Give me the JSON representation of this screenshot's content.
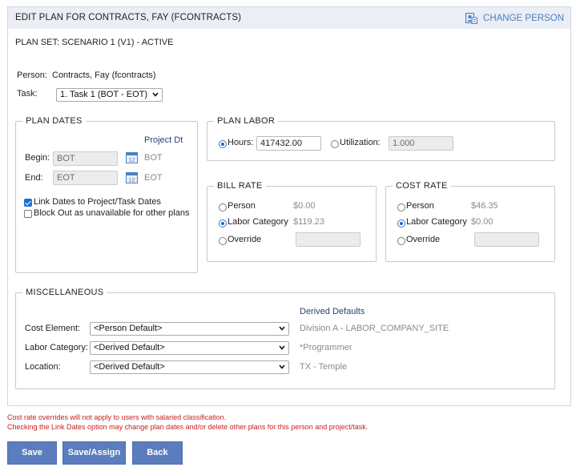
{
  "header": {
    "title": "EDIT PLAN FOR CONTRACTS, FAY (FCONTRACTS)",
    "change_person": "CHANGE PERSON"
  },
  "plan_set": "PLAN SET:  SCENARIO 1 (V1) - ACTIVE",
  "person": {
    "label": "Person:",
    "value": "Contracts, Fay (fcontracts)"
  },
  "task": {
    "label": "Task:",
    "selected": "1. Task 1 (BOT - EOT)"
  },
  "plan_dates": {
    "legend": "PLAN DATES",
    "project_dt_header": "Project Dt",
    "begin_label": "Begin:",
    "begin_value": "BOT",
    "begin_project": "BOT",
    "end_label": "End:",
    "end_value": "EOT",
    "end_project": "EOT",
    "link_dates_label": "Link Dates to Project/Task Dates",
    "block_out_label": "Block Out as unavailable for other plans"
  },
  "plan_labor": {
    "legend": "PLAN LABOR",
    "hours_label": "Hours:",
    "hours_value": "417432.00",
    "utilization_label": "Utilization:",
    "utilization_value": "1.000"
  },
  "bill_rate": {
    "legend": "BILL RATE",
    "person_label": "Person",
    "person_value": "$0.00",
    "labor_category_label": "Labor Category",
    "labor_category_value": "$119.23",
    "override_label": "Override",
    "override_value": ""
  },
  "cost_rate": {
    "legend": "COST RATE",
    "person_label": "Person",
    "person_value": "$46.35",
    "labor_category_label": "Labor Category",
    "labor_category_value": "$0.00",
    "override_label": "Override",
    "override_value": ""
  },
  "misc": {
    "legend": "MISCELLANEOUS",
    "derived_header": "Derived Defaults",
    "cost_element_label": "Cost Element:",
    "cost_element_selected": "<Person Default>",
    "cost_element_derived": "Division A - LABOR_COMPANY_SITE",
    "labor_category_label": "Labor Category:",
    "labor_category_selected": "<Derived Default>",
    "labor_category_derived": "*Programmer",
    "location_label": "Location:",
    "location_selected": "<Derived Default>",
    "location_derived": "TX - Temple"
  },
  "notes": [
    "Cost rate overrides will not apply to users with salaried classification.",
    "Checking the Link Dates option may change plan dates and/or delete other plans for this person and project/task."
  ],
  "buttons": {
    "save": "Save",
    "save_assign": "Save/Assign",
    "back": "Back"
  },
  "colors": {
    "accent": "#5b7dbd",
    "link": "#4a7fc1",
    "warning": "#c81e1e",
    "header_bg": "#ebeef5"
  },
  "icons": {
    "change_person": "person-card-icon",
    "calendar": "calendar-icon",
    "dropdown": "chevron-down-icon"
  }
}
